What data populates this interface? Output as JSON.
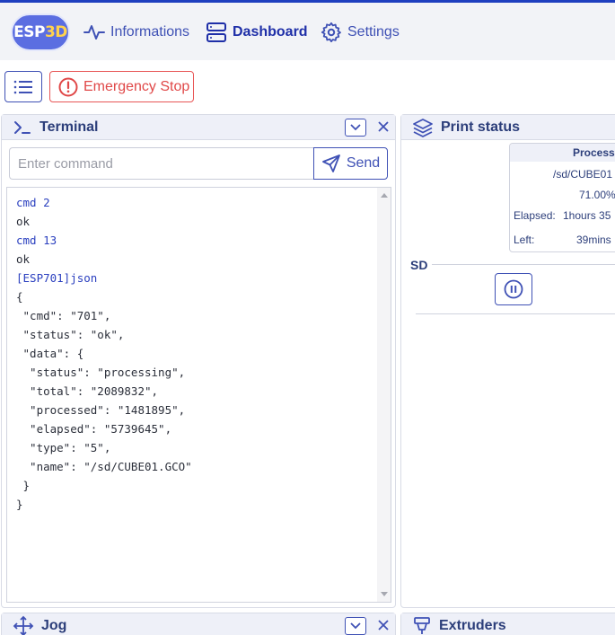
{
  "nav": {
    "logo_prefix": "ESP",
    "logo_suffix": "3D",
    "items": [
      {
        "label": "Informations",
        "icon": "activity-icon"
      },
      {
        "label": "Dashboard",
        "icon": "server-icon",
        "active": true
      },
      {
        "label": "Settings",
        "icon": "gear-icon"
      }
    ]
  },
  "toolbar": {
    "menu_icon": "list-icon",
    "emergency_stop_label": "Emergency Stop"
  },
  "terminal": {
    "title": "Terminal",
    "input_placeholder": "Enter command",
    "send_label": "Send",
    "lines": [
      {
        "text": "cmd 2",
        "kind": "cmd"
      },
      {
        "text": "ok",
        "kind": "resp"
      },
      {
        "text": "cmd 13",
        "kind": "cmd"
      },
      {
        "text": "ok",
        "kind": "resp"
      },
      {
        "text": "[ESP701]json",
        "kind": "cmd"
      },
      {
        "text": "{",
        "kind": "resp"
      },
      {
        "text": " \"cmd\": \"701\",",
        "kind": "resp"
      },
      {
        "text": " \"status\": \"ok\",",
        "kind": "resp"
      },
      {
        "text": " \"data\": {",
        "kind": "resp"
      },
      {
        "text": "  \"status\": \"processing\",",
        "kind": "resp"
      },
      {
        "text": "  \"total\": \"2089832\",",
        "kind": "resp"
      },
      {
        "text": "  \"processed\": \"1481895\",",
        "kind": "resp"
      },
      {
        "text": "  \"elapsed\": \"5739645\",",
        "kind": "resp"
      },
      {
        "text": "  \"type\": \"5\",",
        "kind": "resp"
      },
      {
        "text": "  \"name\": \"/sd/CUBE01.GCO\"",
        "kind": "resp"
      },
      {
        "text": " }",
        "kind": "resp"
      },
      {
        "text": "}",
        "kind": "resp"
      }
    ]
  },
  "print_status": {
    "title": "Print status",
    "state": "Processin",
    "file": "/sd/CUBE01",
    "progress": "71.00%",
    "elapsed_label": "Elapsed:",
    "elapsed_value": "1hours  35",
    "left_label": "Left:",
    "left_value": "39mins",
    "sd_label": "SD"
  },
  "jog": {
    "title": "Jog"
  },
  "extruders": {
    "title": "Extruders"
  },
  "colors": {
    "primary": "#3f51b5",
    "danger": "#e04848",
    "header_bg": "#eef0f8"
  }
}
